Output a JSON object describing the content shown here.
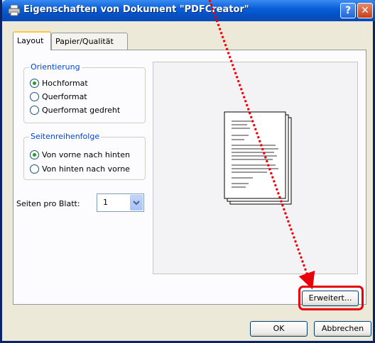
{
  "window": {
    "title": "Eigenschaften von Dokument \"PDFCreator\"",
    "help_glyph": "?",
    "close_glyph": "✕"
  },
  "tabs": [
    {
      "label": "Layout",
      "active": true
    },
    {
      "label": "Papier/Qualität",
      "active": false
    }
  ],
  "orientation": {
    "legend": "Orientierung",
    "options": [
      {
        "label": "Hochformat",
        "checked": true
      },
      {
        "label": "Querformat",
        "checked": false
      },
      {
        "label": "Querformat gedreht",
        "checked": false
      }
    ]
  },
  "page_order": {
    "legend": "Seitenreihenfolge",
    "options": [
      {
        "label": "Von vorne nach hinten",
        "checked": true
      },
      {
        "label": "Von hinten nach vorne",
        "checked": false
      }
    ]
  },
  "pages_per_sheet": {
    "label": "Seiten pro Blatt:",
    "value": "1"
  },
  "buttons": {
    "advanced": "Erweitert...",
    "ok": "OK",
    "cancel": "Abbrechen"
  },
  "colors": {
    "accent_group_text": "#0046d5",
    "annotation_red": "#e8000b",
    "titlebar_blue": "#0551c6"
  },
  "icons": {
    "title_icon": "printer-icon",
    "dropdown": "chevron-down-icon"
  }
}
